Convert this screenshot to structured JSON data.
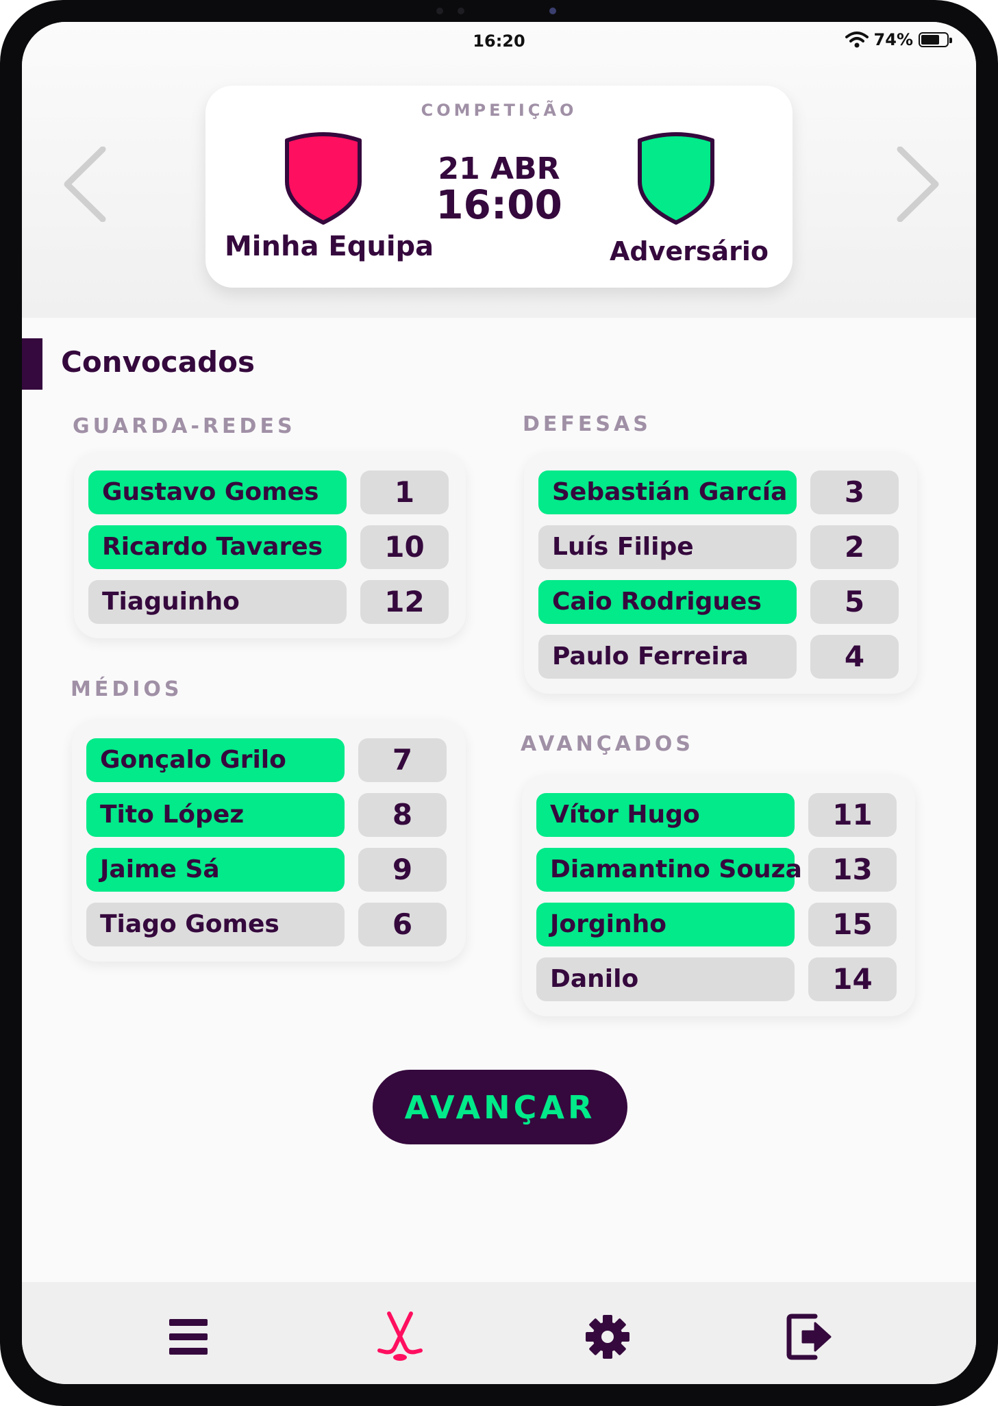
{
  "status": {
    "time": "16:20",
    "battery": "74%",
    "battery_level": 0.74
  },
  "match": {
    "competition": "COMPETIÇÃO",
    "home_team": "Minha Equipa",
    "away_team": "Adversário",
    "date": "21 ABR",
    "time": "16:00",
    "home_color": "#ff0f5f",
    "away_color": "#02ea89"
  },
  "section_title": "Convocados",
  "groups": {
    "goalkeepers": {
      "label": "GUARDA-REDES",
      "players": [
        {
          "name": "Gustavo Gomes",
          "number": "1",
          "selected": true
        },
        {
          "name": "Ricardo Tavares",
          "number": "10",
          "selected": true
        },
        {
          "name": "Tiaguinho",
          "number": "12",
          "selected": false
        }
      ]
    },
    "defenders": {
      "label": "DEFESAS",
      "players": [
        {
          "name": "Sebastián García",
          "number": "3",
          "selected": true
        },
        {
          "name": "Luís Filipe",
          "number": "2",
          "selected": false
        },
        {
          "name": "Caio Rodrigues",
          "number": "5",
          "selected": true
        },
        {
          "name": "Paulo Ferreira",
          "number": "4",
          "selected": false
        }
      ]
    },
    "midfielders": {
      "label": "MÉDIOS",
      "players": [
        {
          "name": "Gonçalo Grilo",
          "number": "7",
          "selected": true
        },
        {
          "name": "Tito López",
          "number": "8",
          "selected": true
        },
        {
          "name": "Jaime Sá",
          "number": "9",
          "selected": true
        },
        {
          "name": "Tiago Gomes",
          "number": "6",
          "selected": false
        }
      ]
    },
    "forwards": {
      "label": "AVANÇADOS",
      "players": [
        {
          "name": "Vítor Hugo",
          "number": "11",
          "selected": true
        },
        {
          "name": "Diamantino Souza",
          "number": "13",
          "selected": true
        },
        {
          "name": "Jorginho",
          "number": "15",
          "selected": true
        },
        {
          "name": "Danilo",
          "number": "14",
          "selected": false
        }
      ]
    }
  },
  "advance_label": "AVANÇAR",
  "tabs": [
    {
      "icon": "menu-icon",
      "active": false
    },
    {
      "icon": "hockey-sticks-icon",
      "active": true
    },
    {
      "icon": "gear-icon",
      "active": false
    },
    {
      "icon": "logout-icon",
      "active": false
    }
  ],
  "colors": {
    "accent": "#02ea89",
    "primary": "#35093d",
    "active_tab": "#ff0f5f",
    "muted_label": "#a090a6",
    "unselected": "#dcdcdc"
  }
}
